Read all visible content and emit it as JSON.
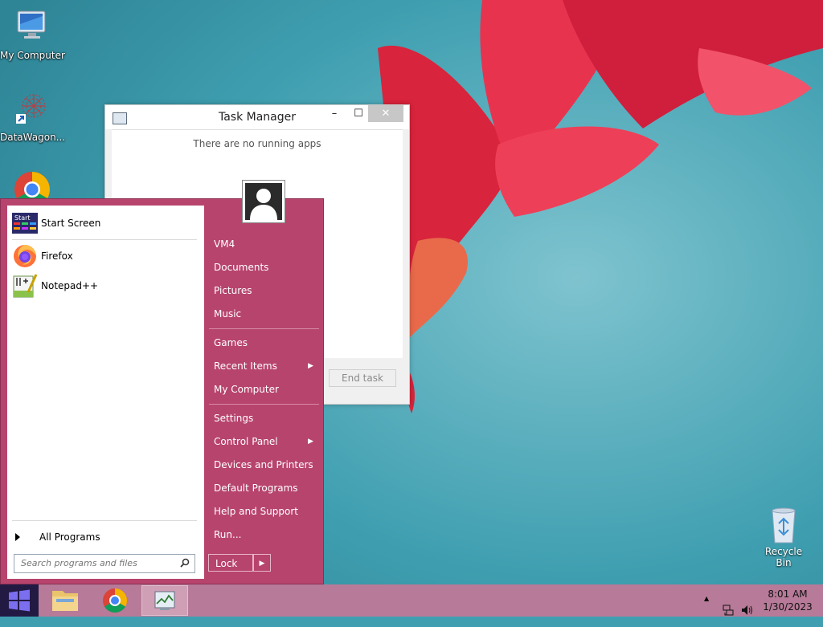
{
  "desktop": {
    "icons": [
      {
        "label": "My Computer",
        "icon": "my-computer-icon"
      },
      {
        "label": "DataWagon...",
        "icon": "datawagon-icon"
      },
      {
        "label": "",
        "icon": "chrome-icon"
      }
    ],
    "recycle_bin": {
      "label": "Recycle Bin",
      "icon": "recycle-bin-icon"
    }
  },
  "task_manager": {
    "title": "Task Manager",
    "min_glyph": "–",
    "max_glyph": "☐",
    "close_glyph": "✕",
    "message": "There are no running apps",
    "end_task_label": "End task"
  },
  "start_menu": {
    "pinned": [
      {
        "label": "Start Screen",
        "icon": "start-screen-icon"
      },
      {
        "label": "Firefox",
        "icon": "firefox-icon"
      },
      {
        "label": "Notepad++",
        "icon": "notepad-plus-plus-icon"
      }
    ],
    "all_programs_label": "All Programs",
    "search_placeholder": "Search programs and files",
    "right_items": [
      {
        "label": "VM4",
        "submenu": false
      },
      {
        "label": "Documents",
        "submenu": false
      },
      {
        "label": "Pictures",
        "submenu": false
      },
      {
        "label": "Music",
        "submenu": false
      },
      {
        "label": "Games",
        "submenu": false
      },
      {
        "label": "Recent Items",
        "submenu": true
      },
      {
        "label": "My Computer",
        "submenu": false
      },
      {
        "label": "Settings",
        "submenu": false
      },
      {
        "label": "Control Panel",
        "submenu": true
      },
      {
        "label": "Devices and Printers",
        "submenu": false
      },
      {
        "label": "Default Programs",
        "submenu": false
      },
      {
        "label": "Help and Support",
        "submenu": false
      },
      {
        "label": "Run...",
        "submenu": false
      }
    ],
    "lock_label": "Lock",
    "submenu_arrow": "▶",
    "start_tile_text": "Start"
  },
  "taskbar": {
    "apps": [
      {
        "name": "file-explorer",
        "icon": "file-explorer-icon"
      },
      {
        "name": "chrome",
        "icon": "chrome-icon"
      },
      {
        "name": "task-manager",
        "icon": "task-manager-icon",
        "active": true
      }
    ],
    "tray_up_arrow": "▲",
    "time": "8:01 AM",
    "date": "1/30/2023"
  },
  "colors": {
    "start_menu_bg": "#b7446d",
    "taskbar_bg": "#b77a98",
    "start_button_bg": "#231a44",
    "desktop_bg": "#3f9fb0"
  }
}
